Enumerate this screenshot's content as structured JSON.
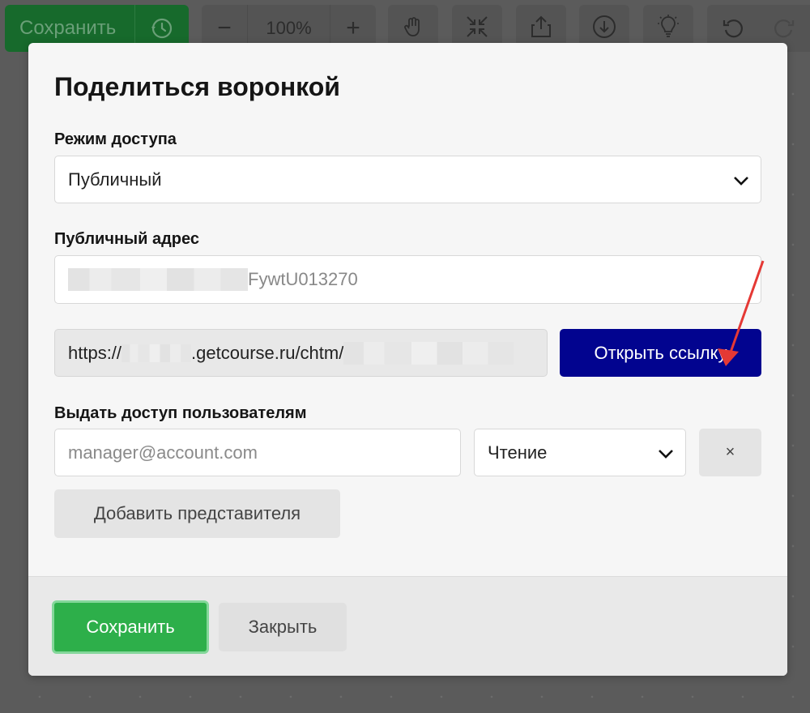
{
  "toolbar": {
    "save_label": "Сохранить",
    "zoom_minus": "−",
    "zoom_value": "100%",
    "zoom_plus": "+"
  },
  "modal": {
    "title": "Поделиться воронкой",
    "access_mode": {
      "label": "Режим доступа",
      "value": "Публичный"
    },
    "public_address": {
      "label": "Публичный адрес",
      "value_visible": "FywtU013270"
    },
    "url": {
      "prefix": "https://",
      "middle": ".getcourse.ru/chtm/"
    },
    "open_link_label": "Открыть ссылку",
    "grant_access": {
      "label": "Выдать доступ пользователям",
      "email_placeholder": "manager@account.com",
      "permission_value": "Чтение",
      "remove_label": "×"
    },
    "add_representative_label": "Добавить представителя",
    "footer": {
      "save_label": "Сохранить",
      "close_label": "Закрыть"
    }
  },
  "colors": {
    "primary_blue": "#02048f",
    "save_green": "#2daf4a",
    "annotation_arrow": "#e53935"
  }
}
